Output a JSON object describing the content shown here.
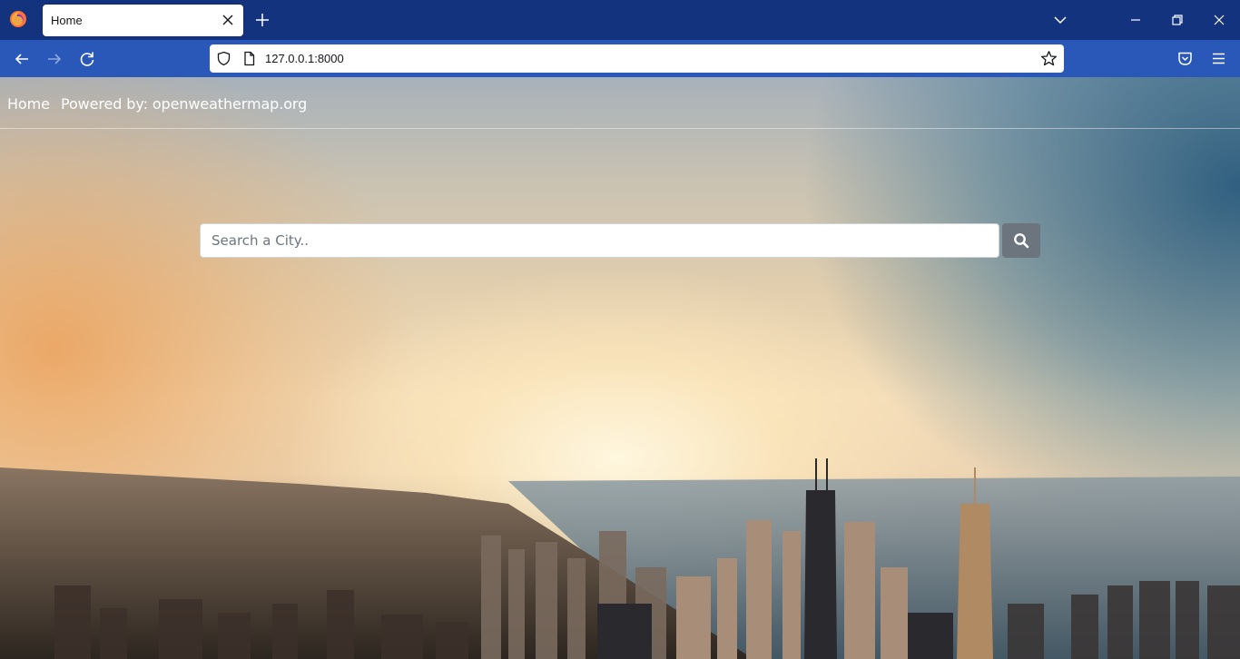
{
  "browser": {
    "tab_title": "Home",
    "url": "127.0.0.1:8000",
    "icons": {
      "logo": "firefox-logo-icon",
      "tab_close": "close-icon",
      "new_tab": "plus-icon",
      "tab_list": "chevron-down-icon",
      "back": "arrow-left-icon",
      "forward": "arrow-right-icon",
      "reload": "reload-icon",
      "security": "shield-icon",
      "page": "page-icon",
      "bookmark": "star-icon",
      "pocket": "pocket-icon",
      "menu": "hamburger-menu-icon"
    },
    "colors": {
      "tabstrip": "#14337f",
      "navbar": "#2a58b8"
    }
  },
  "site": {
    "nav": {
      "home": "Home",
      "powered": "Powered by: openweathermap.org"
    },
    "search": {
      "placeholder": "Search a City..",
      "value": "",
      "button_icon": "search-icon"
    },
    "colors": {
      "search_button": "#6c757d"
    }
  }
}
